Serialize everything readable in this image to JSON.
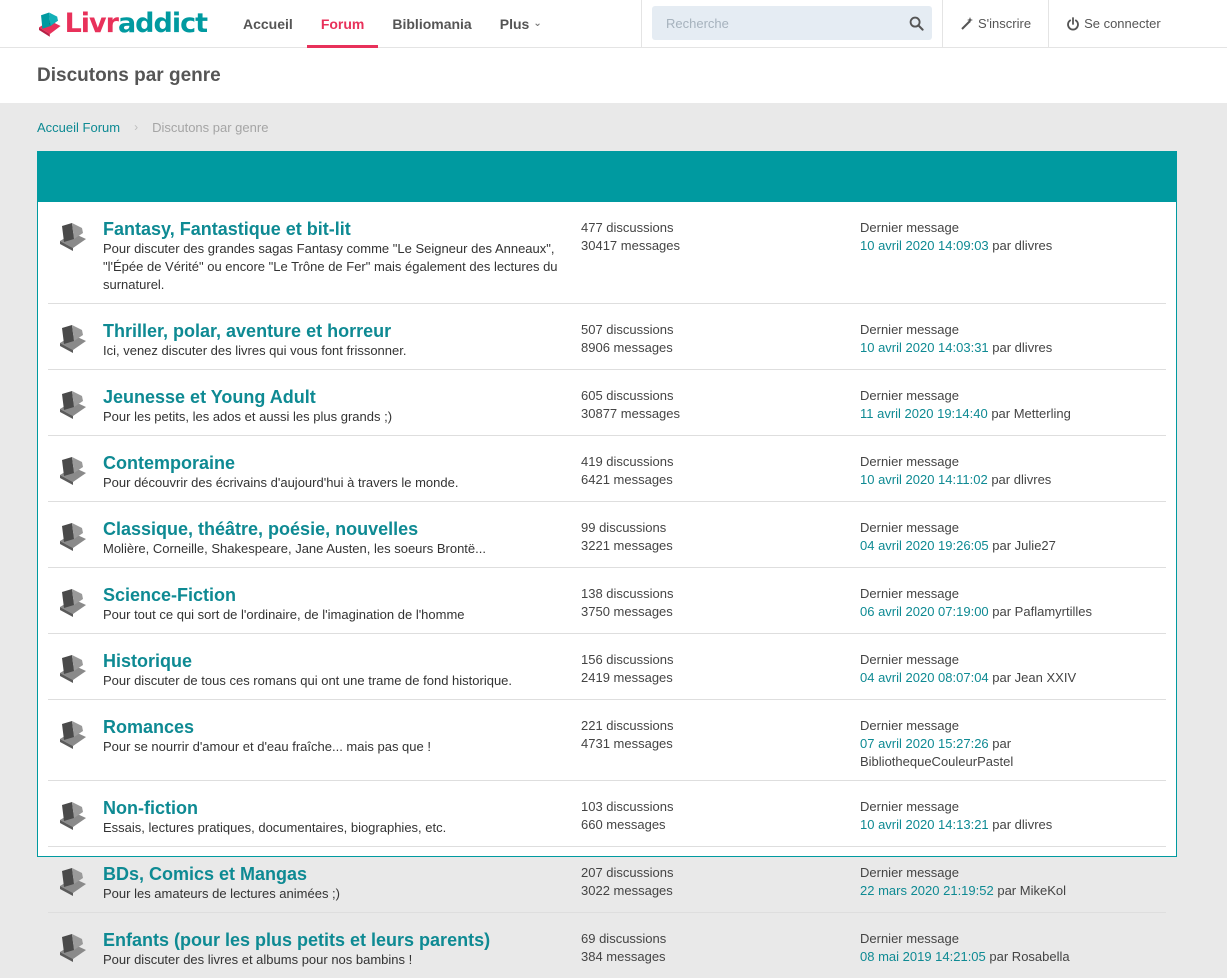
{
  "brand": {
    "name_part1": "Livr",
    "name_part2": "addict"
  },
  "nav": {
    "items": [
      {
        "label": "Accueil"
      },
      {
        "label": "Forum"
      },
      {
        "label": "Bibliomania"
      },
      {
        "label": "Plus"
      }
    ]
  },
  "search": {
    "placeholder": "Recherche"
  },
  "auth": {
    "register": "S'inscrire",
    "login": "Se connecter"
  },
  "page": {
    "title": "Discutons par genre"
  },
  "breadcrumb": {
    "home": "Accueil Forum",
    "current": "Discutons par genre"
  },
  "colors": {
    "accent": "#009aa0",
    "brand_pink": "#e8315a",
    "link": "#0e8a93"
  },
  "categories": [
    {
      "title": "Fantasy, Fantastique et bit-lit",
      "desc": "Pour discuter des grandes sagas Fantasy comme \"Le Seigneur des Anneaux\", \"l'Épée de Vérité\" ou encore \"Le Trône de Fer\" mais également des lectures du surnaturel.",
      "discussions": "477 discussions",
      "messages": "30417 messages",
      "last_label": "Dernier message",
      "last_date": "10 avril 2020 14:09:03",
      "last_by": "par dlivres"
    },
    {
      "title": "Thriller, polar, aventure et horreur",
      "desc": "Ici, venez discuter des livres qui vous font frissonner.",
      "discussions": "507 discussions",
      "messages": "8906 messages",
      "last_label": "Dernier message",
      "last_date": "10 avril 2020 14:03:31",
      "last_by": "par dlivres"
    },
    {
      "title": "Jeunesse et Young Adult",
      "desc": "Pour les petits, les ados et aussi les plus grands ;)",
      "discussions": "605 discussions",
      "messages": "30877 messages",
      "last_label": "Dernier message",
      "last_date": "11 avril 2020 19:14:40",
      "last_by": "par Metterling"
    },
    {
      "title": "Contemporaine",
      "desc": "Pour découvrir des écrivains d'aujourd'hui à travers le monde.",
      "discussions": "419 discussions",
      "messages": "6421 messages",
      "last_label": "Dernier message",
      "last_date": "10 avril 2020 14:11:02",
      "last_by": "par dlivres"
    },
    {
      "title": "Classique, théâtre, poésie, nouvelles",
      "desc": "Molière, Corneille, Shakespeare, Jane Austen, les soeurs Brontë...",
      "discussions": "99 discussions",
      "messages": "3221 messages",
      "last_label": "Dernier message",
      "last_date": "04 avril 2020 19:26:05",
      "last_by": "par Julie27"
    },
    {
      "title": "Science-Fiction",
      "desc": "Pour tout ce qui sort de l'ordinaire, de l'imagination de l'homme",
      "discussions": "138 discussions",
      "messages": "3750 messages",
      "last_label": "Dernier message",
      "last_date": "06 avril 2020 07:19:00",
      "last_by": "par Paflamyrtilles"
    },
    {
      "title": "Historique",
      "desc": "Pour discuter de tous ces romans qui ont une trame de fond historique.",
      "discussions": "156 discussions",
      "messages": "2419 messages",
      "last_label": "Dernier message",
      "last_date": "04 avril 2020 08:07:04",
      "last_by": "par Jean XXIV"
    },
    {
      "title": "Romances",
      "desc": "Pour se nourrir d'amour et d'eau fraîche... mais pas que !",
      "discussions": "221 discussions",
      "messages": "4731 messages",
      "last_label": "Dernier message",
      "last_date": "07 avril 2020 15:27:26",
      "last_by": "par BibliothequeCouleurPastel"
    },
    {
      "title": "Non-fiction",
      "desc": "Essais, lectures pratiques, documentaires, biographies, etc.",
      "discussions": "103 discussions",
      "messages": "660 messages",
      "last_label": "Dernier message",
      "last_date": "10 avril 2020 14:13:21",
      "last_by": "par dlivres"
    },
    {
      "title": "BDs, Comics et Mangas",
      "desc": "Pour les amateurs de lectures animées ;)",
      "discussions": "207 discussions",
      "messages": "3022 messages",
      "last_label": "Dernier message",
      "last_date": "22 mars 2020 21:19:52",
      "last_by": "par MikeKol"
    },
    {
      "title": "Enfants (pour les plus petits et leurs parents)",
      "desc": "Pour discuter des livres et albums pour nos bambins !",
      "discussions": "69 discussions",
      "messages": "384 messages",
      "last_label": "Dernier message",
      "last_date": "08 mai 2019 14:21:05",
      "last_by": "par Rosabella"
    }
  ]
}
